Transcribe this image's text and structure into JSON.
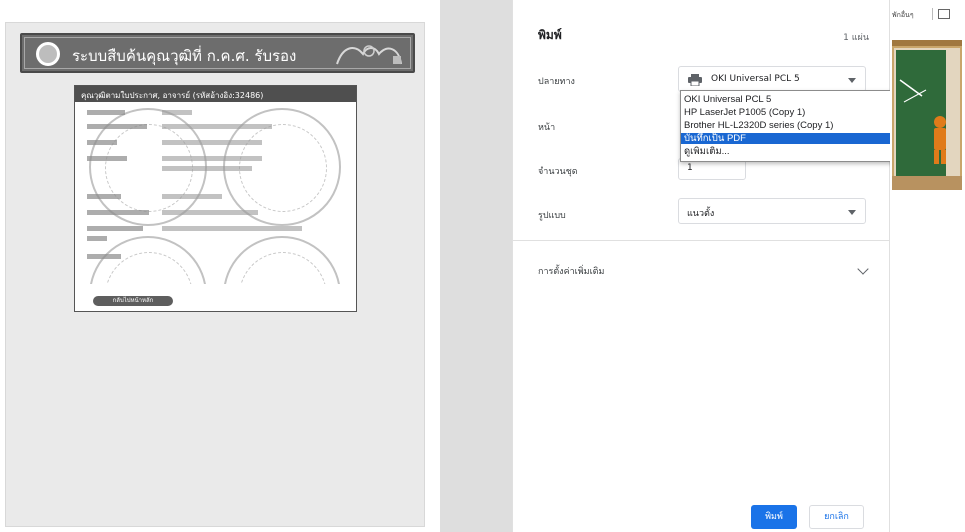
{
  "preview": {
    "banner_title": "ระบบสืบค้นคุณวุฒิที่ ก.ค.ศ. รับรอง",
    "card_header": "คุณวุฒิตามใบประกาศ, อาจารย์ (รหัสอ้างอิง:32486)",
    "back_button": "กลับไปหน้าหลัก"
  },
  "dialog": {
    "title": "พิมพ์",
    "sheet_count": "1 แผ่น",
    "destination": {
      "label": "ปลายทาง",
      "icon": "printer-icon",
      "value": "OKI Universal PCL 5",
      "options": [
        "OKI Universal PCL 5",
        "HP LaserJet P1005 (Copy 1)",
        "Brother HL-L2320D series (Copy 1)",
        "บันทึกเป็น PDF",
        "ดูเพิ่มเติม..."
      ],
      "highlighted_option": "บันทึกเป็น PDF"
    },
    "pages": {
      "label": "หน้า"
    },
    "copies": {
      "label": "จำนวนชุด",
      "value": "1"
    },
    "layout": {
      "label": "รูปแบบ",
      "value": "แนวตั้ง"
    },
    "more_settings": {
      "label": "การตั้งค่าเพิ่มเติม"
    },
    "print_button": "พิมพ์",
    "cancel_button": "ยกเลิก",
    "accent_color": "#1a73e8",
    "highlight_color": "#1967d2"
  },
  "background_page": {
    "toolbar_text": "พักอื่นๆ"
  }
}
